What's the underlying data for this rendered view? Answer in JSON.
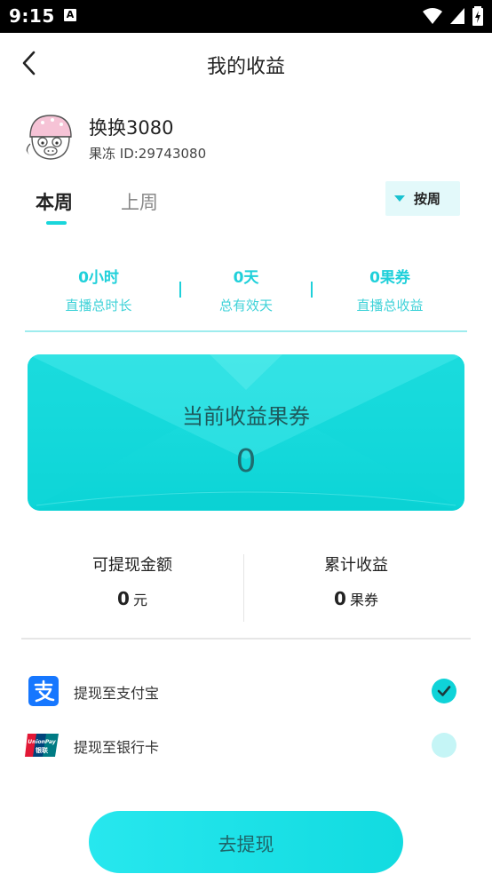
{
  "status_bar": {
    "time": "9:15",
    "notification_glyph": "A"
  },
  "header": {
    "title": "我的收益"
  },
  "profile": {
    "name": "换换3080",
    "id_text": "果冻 ID:29743080"
  },
  "tabs": [
    {
      "label": "本周",
      "active": true
    },
    {
      "label": "上周",
      "active": false
    }
  ],
  "period_button": {
    "label": "按周"
  },
  "stats": [
    {
      "value": "0小时",
      "label": "直播总时长"
    },
    {
      "value": "0天",
      "label": "总有效天"
    },
    {
      "value": "0果券",
      "label": "直播总收益"
    }
  ],
  "earnings_card": {
    "title": "当前收益果券",
    "value": "0"
  },
  "balance": {
    "withdrawable": {
      "label": "可提现金额",
      "value": "0",
      "unit": "元"
    },
    "cumulative": {
      "label": "累计收益",
      "value": "0",
      "unit": "果券"
    }
  },
  "methods": [
    {
      "label": "提现至支付宝",
      "icon": "alipay-icon",
      "selected": true
    },
    {
      "label": "提现至银行卡",
      "icon": "unionpay-icon",
      "selected": false
    }
  ],
  "icon_text": {
    "unionpay_top": "UnionPay",
    "unionpay_bottom": "银联"
  },
  "withdraw_button": {
    "label": "去提现"
  },
  "colors": {
    "accent": "#19d6db",
    "card": "#0bd4d6",
    "status_bar": "#000000"
  }
}
